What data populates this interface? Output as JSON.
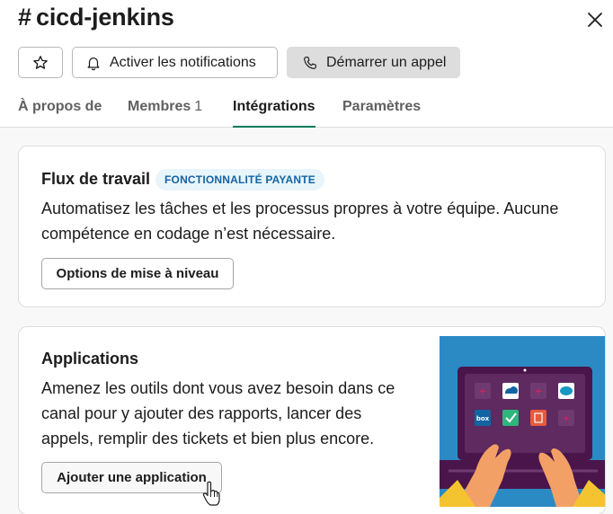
{
  "header": {
    "title": "# cicd-jenkins",
    "star_icon": "star-icon",
    "close_icon": "close-icon",
    "notify_label": "Activer les notifications",
    "call_label": "Démarrer un appel"
  },
  "tabs": [
    {
      "label": "À propos de",
      "active": false
    },
    {
      "label": "Membres",
      "count": "1",
      "active": false
    },
    {
      "label": "Intégrations",
      "active": true
    },
    {
      "label": "Paramètres",
      "active": false
    }
  ],
  "workflow": {
    "title": "Flux de travail",
    "badge": "FONCTIONNALITÉ PAYANTE",
    "description_line1": "Automatisez les tâches et les processus propres à votre équipe. Aucune",
    "description_line2": "compétence en codage n’est nécessaire.",
    "button_label": "Options de mise à niveau"
  },
  "apps": {
    "title": "Applications",
    "description_line1": "Amenez les outils dont vous avez besoin dans ce",
    "description_line2": "canal pour y ajouter des rapports, lancer des",
    "description_line3": "appels, remplir des tickets et bien plus encore.",
    "button_label": "Ajouter une application",
    "illustration_logos": [
      "box",
      "salesforce"
    ]
  },
  "colors": {
    "accent_green": "#007a5a",
    "badge_bg": "#e8f5fa",
    "badge_text": "#1264a3",
    "illustration_bg": "#2b8ac4",
    "laptop_purple": "#4a154b"
  }
}
